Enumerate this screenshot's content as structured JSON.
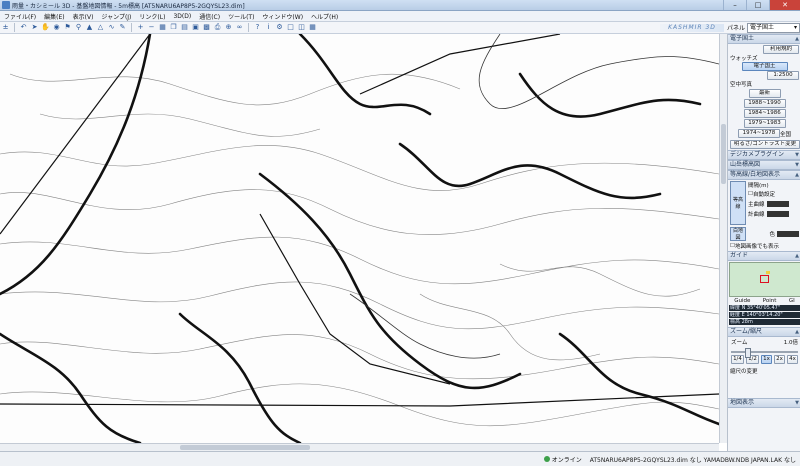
{
  "window": {
    "title": "雨量・カシミール 3D - 基盤地図情報 - 5m標高 [AT5NARU6AP8P5-2GQYSL23.dim]"
  },
  "menu": [
    "ファイル(F)",
    "編集(E)",
    "表示(V)",
    "ジャンプ(J)",
    "リンク(L)",
    "3D(D)",
    "通信(C)",
    "ツール(T)",
    "ウィンドウ(W)",
    "ヘルプ(H)"
  ],
  "toolbar": {
    "logo_text": "KASHMIR 3D",
    "panel_label": "パネル",
    "panel_value": "電子国土"
  },
  "side": {
    "denshi": {
      "header": "電子国土",
      "usage_btn": "利用規約",
      "watch_label": "ウォッチズ",
      "denshi_btn": "電子国土",
      "scale": "1:2500",
      "aerial_label": "空中写真",
      "latest_btn": "最新",
      "periods": [
        "1988~1990",
        "1984~1986",
        "1979~1983",
        "1974~1978"
      ],
      "all_label": "全国",
      "contrast_btn": "明るさ/コントラスト変更"
    },
    "digital_header": "デジカメプラグイン",
    "mountain_header": "山岳標高図",
    "contour": {
      "header": "等高線/白地図表示",
      "interval_label": "間隔(m)",
      "contour_tab": "等高線",
      "auto_label": "自動設定",
      "major_label": "主曲線",
      "minor_label": "計曲線",
      "whitemap_tab": "白地図",
      "color_label": "色",
      "note_check": "地図画像でも表示"
    },
    "guide": {
      "header": "ガイド",
      "tabs": [
        "Guide",
        "Point",
        "GI"
      ],
      "lat": "緯度  N 35°40'05.47\"",
      "lon": "経度  E 140°03'14.20\"",
      "elev": "標高  28m"
    },
    "zoom": {
      "header": "ズーム/縮尺",
      "zoom_label": "ズーム",
      "zoom_value": "1.0倍",
      "presets": [
        "1/4",
        "1/2",
        "1x",
        "2x",
        "4x"
      ],
      "change_label": "縮尺の変更"
    },
    "map_display_header": "地図表示"
  },
  "statusbar": {
    "online": "オンライン",
    "file": "AT5NARU6AP8P5-2GQYSL23.dim なし YAMADBW.NDB JAPAN.LAK なし"
  }
}
